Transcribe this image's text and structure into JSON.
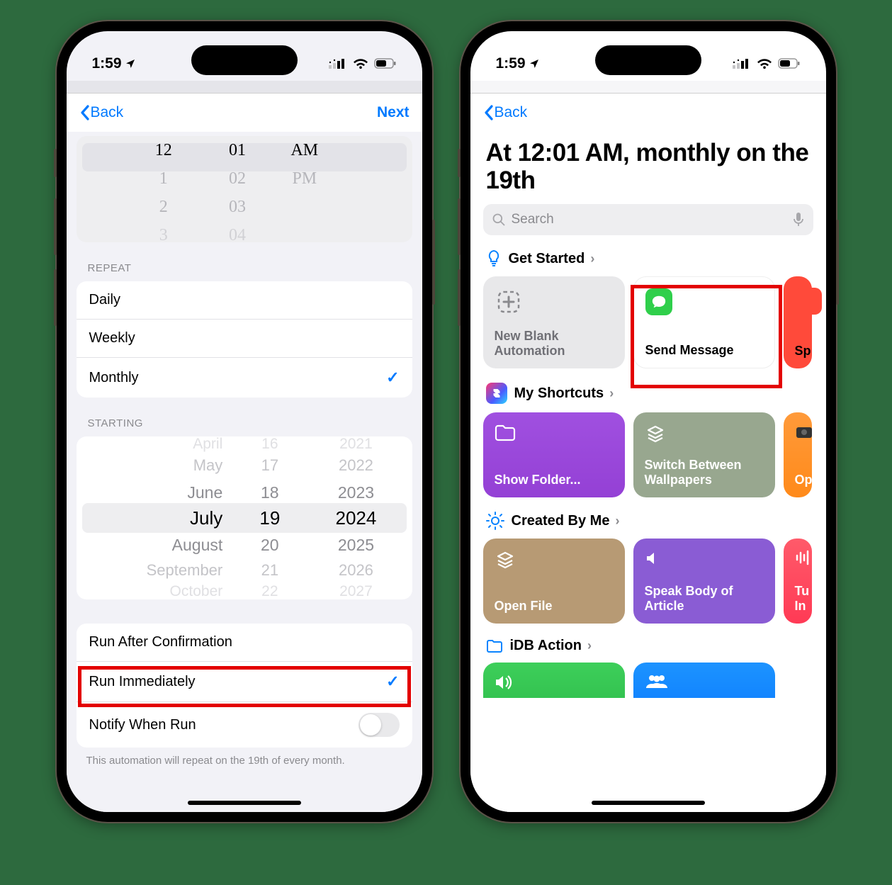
{
  "status": {
    "time": "1:59"
  },
  "left": {
    "nav": {
      "back": "Back",
      "next": "Next"
    },
    "time_picker": {
      "hours": [
        "12",
        "1",
        "2",
        "3"
      ],
      "minutes": [
        "01",
        "02",
        "03",
        "04"
      ],
      "ampm": [
        "AM",
        "PM"
      ]
    },
    "repeat": {
      "header": "REPEAT",
      "options": [
        "Daily",
        "Weekly",
        "Monthly"
      ],
      "selected": "Monthly"
    },
    "starting": {
      "header": "STARTING",
      "rows": [
        {
          "m": "April",
          "d": "16",
          "y": "2021"
        },
        {
          "m": "May",
          "d": "17",
          "y": "2022"
        },
        {
          "m": "June",
          "d": "18",
          "y": "2023"
        },
        {
          "m": "July",
          "d": "19",
          "y": "2024"
        },
        {
          "m": "August",
          "d": "20",
          "y": "2025"
        },
        {
          "m": "September",
          "d": "21",
          "y": "2026"
        },
        {
          "m": "October",
          "d": "22",
          "y": "2027"
        }
      ],
      "selected_index": 3
    },
    "run": {
      "after": "Run After Confirmation",
      "immediately": "Run Immediately",
      "notify": "Notify When Run"
    },
    "footer": "This automation will repeat on the 19th of every month."
  },
  "right": {
    "nav": {
      "back": "Back"
    },
    "title": "At 12:01 AM, monthly on the 19th",
    "search": {
      "placeholder": "Search"
    },
    "get_started": {
      "header": "Get Started",
      "cards": [
        {
          "id": "new-blank",
          "title": "New Blank Automation"
        },
        {
          "id": "send-message",
          "title": "Send Message"
        },
        {
          "id": "sp",
          "title": "Sp"
        }
      ]
    },
    "my_shortcuts": {
      "header": "My Shortcuts",
      "cards": [
        {
          "id": "show-folder",
          "title": "Show Folder..."
        },
        {
          "id": "switch-wallpapers",
          "title": "Switch Between Wallpapers"
        },
        {
          "id": "op",
          "title": "Op"
        }
      ]
    },
    "created_by_me": {
      "header": "Created By Me",
      "cards": [
        {
          "id": "open-file",
          "title": "Open File"
        },
        {
          "id": "speak-body",
          "title": "Speak Body of Article"
        },
        {
          "id": "tu",
          "title": "Tu\nIn"
        }
      ]
    },
    "idb_action": {
      "header": "iDB Action"
    }
  }
}
